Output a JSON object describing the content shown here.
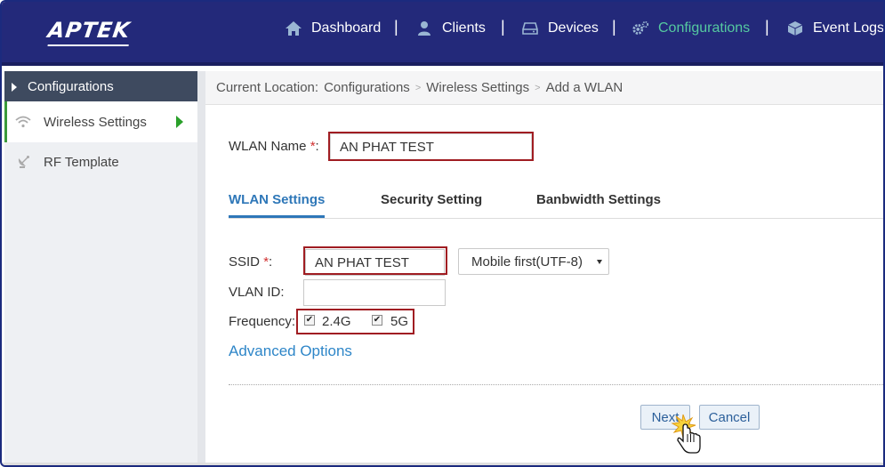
{
  "app": {
    "logo": "APTEK",
    "nav": [
      {
        "label": "Dashboard",
        "icon": "home-icon"
      },
      {
        "label": "Clients",
        "icon": "user-icon"
      },
      {
        "label": "Devices",
        "icon": "hard-drive-icon"
      },
      {
        "label": "Configurations",
        "icon": "gears-icon",
        "active": true
      },
      {
        "label": "Event Logs",
        "icon": "cube-icon"
      }
    ],
    "nav_separator": "|"
  },
  "sidebar": {
    "header": "Configurations",
    "items": [
      {
        "label": "Wireless Settings",
        "icon": "wifi-icon",
        "active": true
      },
      {
        "label": "RF Template",
        "icon": "satellite-dish-icon"
      }
    ]
  },
  "breadcrumb": {
    "prefix": "Current Location:",
    "items": [
      "Configurations",
      "Wireless Settings",
      "Add a WLAN"
    ],
    "separator": ">"
  },
  "form": {
    "wlan_name_label": "WLAN Name",
    "required_mark": "*",
    "colon": ":",
    "wlan_name_value": "AN PHAT TEST",
    "tabs": [
      "WLAN Settings",
      "Security Setting",
      "Banbwidth Settings"
    ],
    "ssid_label": "SSID",
    "ssid_value": "AN PHAT TEST",
    "encoding_select": "Mobile first(UTF-8)",
    "vlan_label": "VLAN ID:",
    "vlan_value": "",
    "frequency_label": "Frequency:",
    "freq_24": "2.4G",
    "freq_5": "5G",
    "freq_24_checked": true,
    "freq_5_checked": true,
    "advanced_link": "Advanced Options",
    "next_button": "Next",
    "cancel_button": "Cancel"
  },
  "colors": {
    "topbar": "#23297a",
    "active_nav": "#55c9a0",
    "tab_active": "#2e77b8",
    "highlight_box": "#a01d22",
    "link": "#2e86c8"
  }
}
